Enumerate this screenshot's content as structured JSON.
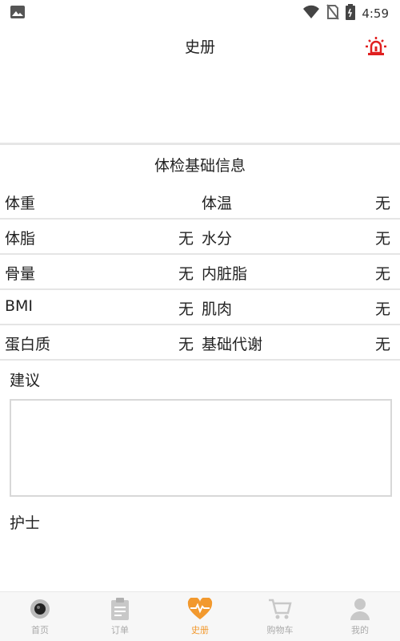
{
  "status_bar": {
    "time": "4:59",
    "icons": [
      "image-icon",
      "wifi-icon",
      "no-sim-icon",
      "battery-icon"
    ]
  },
  "header": {
    "title": "史册",
    "alarm_icon": "alarm-light-icon",
    "alarm_color": "#e02020"
  },
  "section": {
    "title": "体检基础信息"
  },
  "rows": [
    {
      "left_label": "体重",
      "left_value": "",
      "right_label": "体温",
      "right_value": "无"
    },
    {
      "left_label": "体脂",
      "left_value": "无",
      "right_label": "水分",
      "right_value": "无"
    },
    {
      "left_label": "骨量",
      "left_value": "无",
      "right_label": "内脏脂",
      "right_value": "无"
    },
    {
      "left_label": "BMI",
      "left_value": "无",
      "right_label": "肌肉",
      "right_value": "无"
    },
    {
      "left_label": "蛋白质",
      "left_value": "无",
      "right_label": "基础代谢",
      "right_value": "无"
    }
  ],
  "advice": {
    "label": "建议",
    "value": ""
  },
  "nurse": {
    "label": "护士"
  },
  "tabs": [
    {
      "label": "首页",
      "icon": "home-camera-icon",
      "active": false
    },
    {
      "label": "订单",
      "icon": "clipboard-icon",
      "active": false
    },
    {
      "label": "史册",
      "icon": "heart-pulse-icon",
      "active": true
    },
    {
      "label": "购物车",
      "icon": "cart-icon",
      "active": false
    },
    {
      "label": "我的",
      "icon": "person-icon",
      "active": false
    }
  ],
  "colors": {
    "accent": "#f2992e",
    "inactive": "#aaaaaa",
    "alarm": "#e02020"
  }
}
